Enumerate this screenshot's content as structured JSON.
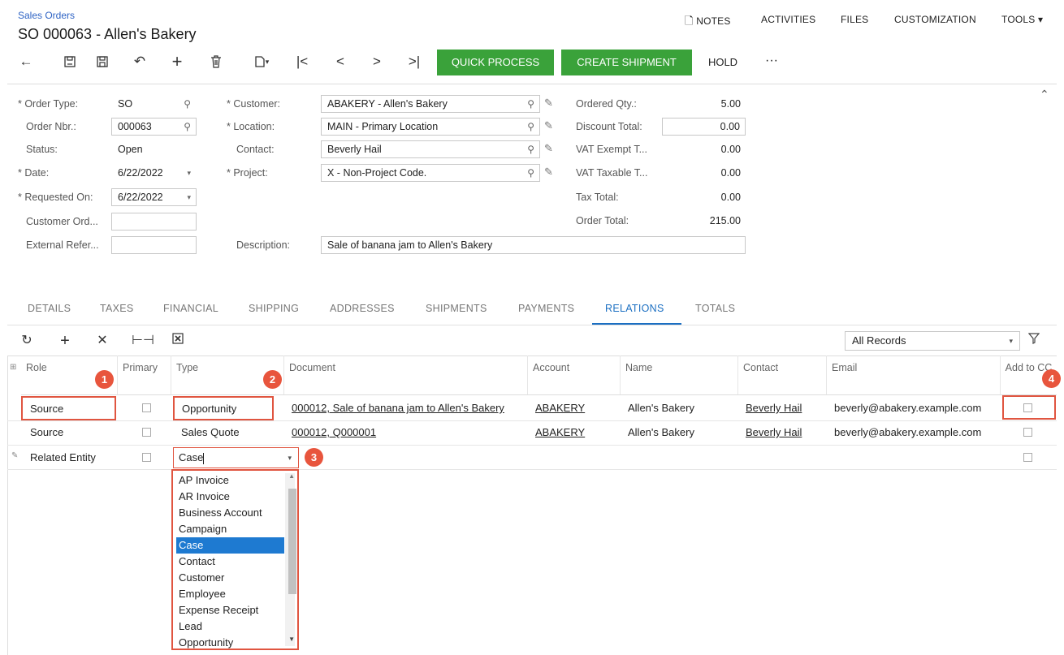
{
  "header": {
    "breadcrumb": "Sales Orders",
    "title": "SO 000063 - Allen's Bakery",
    "menu": {
      "notes": "NOTES",
      "activities": "ACTIVITIES",
      "files": "FILES",
      "customization": "CUSTOMIZATION",
      "tools": "TOOLS ▾"
    }
  },
  "toolbar": {
    "quick_process": "QUICK PROCESS",
    "create_shipment": "CREATE SHIPMENT",
    "hold": "HOLD",
    "more": "···",
    "icons": [
      "back-arrow",
      "undo-save",
      "save",
      "undo",
      "add",
      "delete",
      "copy-paste",
      "first",
      "previous",
      "next",
      "last"
    ],
    "accent": "#3aa23a"
  },
  "form": {
    "order_type_label": "* Order Type:",
    "order_type": "SO",
    "order_nbr_label": "Order Nbr.:",
    "order_nbr": "000063",
    "status_label": "Status:",
    "status": "Open",
    "date_label": "* Date:",
    "date": "6/22/2022",
    "requested_on_label": "* Requested On:",
    "requested_on": "6/22/2022",
    "customer_ord_label": "Customer Ord...",
    "customer_ord": "",
    "external_ref_label": "External Refer...",
    "external_ref": "",
    "customer_label": "* Customer:",
    "customer": "ABAKERY - Allen's Bakery",
    "location_label": "* Location:",
    "location": "MAIN - Primary Location",
    "contact_label": "Contact:",
    "contact": "Beverly Hail",
    "project_label": "* Project:",
    "project": "X - Non-Project Code.",
    "description_label": "Description:",
    "description": "Sale of banana jam to Allen's Bakery",
    "ordered_qty_label": "Ordered Qty.:",
    "ordered_qty": "5.00",
    "discount_total_label": "Discount Total:",
    "discount_total": "0.00",
    "vat_exempt_label": "VAT Exempt T...",
    "vat_exempt": "0.00",
    "vat_taxable_label": "VAT Taxable T...",
    "vat_taxable": "0.00",
    "tax_total_label": "Tax Total:",
    "tax_total": "0.00",
    "order_total_label": "Order Total:",
    "order_total": "215.00"
  },
  "tabs": [
    "DETAILS",
    "TAXES",
    "FINANCIAL",
    "SHIPPING",
    "ADDRESSES",
    "SHIPMENTS",
    "PAYMENTS",
    "RELATIONS",
    "TOTALS"
  ],
  "grid_toolbar": {
    "filter": "All Records"
  },
  "grid": {
    "headers": [
      "Role",
      "Primary",
      "Type",
      "Document",
      "Account",
      "Name",
      "Contact",
      "Email",
      "Add to CC"
    ],
    "rows": [
      {
        "role": "Source",
        "type": "Opportunity",
        "document": "000012, Sale of banana jam to Allen's Bakery",
        "account": "ABAKERY",
        "name": "Allen's Bakery",
        "contact": "Beverly Hail",
        "email": "beverly@abakery.example.com"
      },
      {
        "role": "Source",
        "type": "Sales Quote",
        "document": "000012, Q000001",
        "account": "ABAKERY",
        "name": "Allen's Bakery",
        "contact": "Beverly Hail",
        "email": "beverly@abakery.example.com"
      },
      {
        "role": "Related Entity",
        "type": "Case"
      }
    ]
  },
  "dropdown": {
    "options": [
      "AP Invoice",
      "AR Invoice",
      "Business Account",
      "Campaign",
      "Case",
      "Contact",
      "Customer",
      "Employee",
      "Expense Receipt",
      "Lead",
      "Opportunity"
    ],
    "selected": "Case"
  },
  "badges": [
    "1",
    "2",
    "3",
    "4"
  ],
  "colors": {
    "highlight": "#e05540",
    "selection": "#1e7ad1",
    "tab_active": "#1b6fc2"
  }
}
